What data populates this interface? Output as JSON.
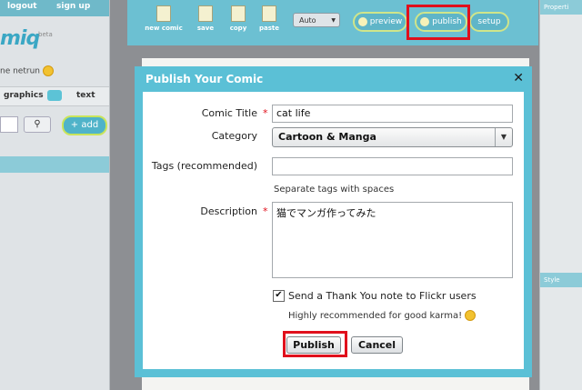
{
  "left_panel": {
    "links": [
      "logout",
      "sign up"
    ],
    "logo_text": "miq",
    "logo_badge": "beta",
    "username": "ne netrun",
    "tabs": {
      "graphics": "graphics",
      "text": "text"
    },
    "search_icon": "magnifier-icon",
    "add_label": "add"
  },
  "toolbar": {
    "new_comic": "new comic",
    "save": "save",
    "copy": "copy",
    "paste": "paste",
    "zoom_value": "Auto",
    "preview": "preview",
    "publish": "publish",
    "setup": "setup"
  },
  "right_panel": {
    "properties": "Properti",
    "style": "Style"
  },
  "dialog": {
    "title": "Publish Your Comic",
    "close_icon": "close-icon",
    "comic_title_label": "Comic Title",
    "comic_title_value": "cat life",
    "category_label": "Category",
    "category_value": "Cartoon & Manga",
    "tags_label": "Tags (recommended)",
    "tags_value": "",
    "tags_hint": "Separate tags with spaces",
    "description_label": "Description",
    "description_value": "猫でマンガ作ってみた",
    "required_mark": "*",
    "thank_you_label": "Send a Thank You note to Flickr users",
    "thank_you_checked": true,
    "karma_note": "Highly recommended for good karma!",
    "publish_button": "Publish",
    "cancel_button": "Cancel"
  },
  "colors": {
    "accent": "#5bc0d6",
    "highlight": "#e0101c"
  }
}
